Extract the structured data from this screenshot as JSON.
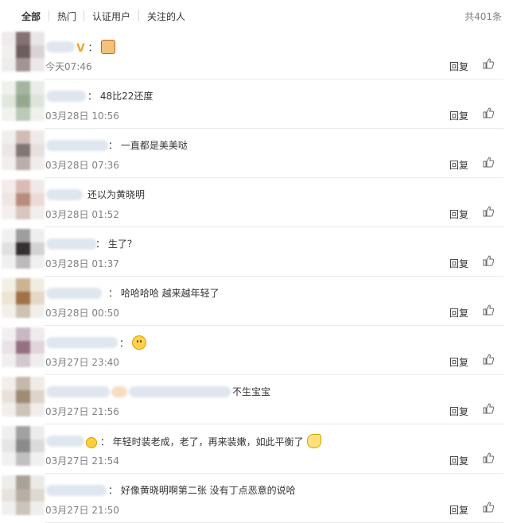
{
  "tabs": {
    "all": "全部",
    "hot": "热门",
    "verified": "认证用户",
    "following": "关注的人",
    "total": "共401条"
  },
  "comments": [
    {
      "prefix": "：",
      "text": "",
      "emoji": "gift-emoji",
      "time": "今天07:46",
      "reply": "回复"
    },
    {
      "prefix": "：",
      "text": "48比22还度",
      "emoji": "",
      "time": "03月28日 10:56",
      "reply": "回复"
    },
    {
      "prefix": "：",
      "text": "一直都是美美哒",
      "emoji": "",
      "time": "03月28日 07:36",
      "reply": "回复"
    },
    {
      "prefix": "",
      "text": "还以为黄晓明",
      "emoji": "",
      "time": "03月28日 01:52",
      "reply": "回复"
    },
    {
      "prefix": "：",
      "text": "生了？",
      "emoji": "",
      "time": "03月28日 01:37",
      "reply": "回复"
    },
    {
      "prefix": "：",
      "text": "哈哈哈哈 越来越年轻了",
      "emoji": "",
      "time": "03月28日 00:50",
      "reply": "回复"
    },
    {
      "prefix": "：",
      "text": "",
      "emoji": "smile-emoji",
      "time": "03月27日 23:40",
      "reply": "回复"
    },
    {
      "prefix": "",
      "text": "不生宝宝",
      "emoji": "",
      "time": "03月27日 21:56",
      "reply": "回复"
    },
    {
      "prefix": "：",
      "text": "年轻时装老成，老了，再来装嫩，如此平衡了",
      "emoji": "think-emoji",
      "time": "03月27日 21:54",
      "reply": "回复"
    },
    {
      "prefix": "：",
      "text": "好像黄晓明啊第二张 没有丁点恶意的说哈",
      "emoji": "",
      "time": "03月27日 21:50",
      "reply": "回复"
    }
  ]
}
